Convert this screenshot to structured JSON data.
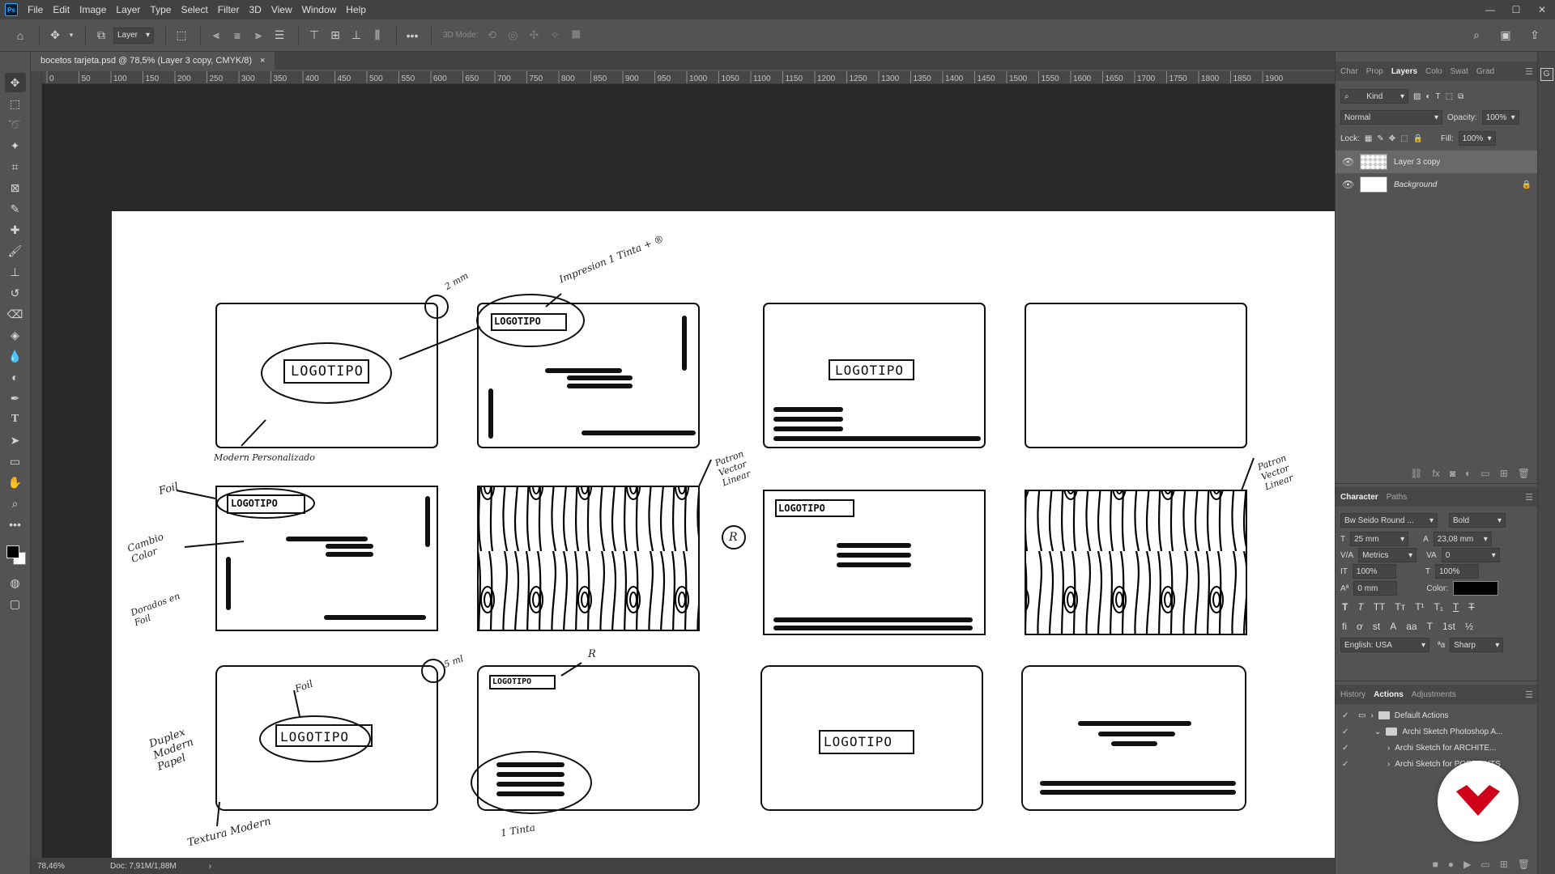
{
  "menubar": {
    "app_icon": "Ps",
    "items": [
      "File",
      "Edit",
      "Image",
      "Layer",
      "Type",
      "Select",
      "Filter",
      "3D",
      "View",
      "Window",
      "Help"
    ]
  },
  "options": {
    "auto_select_target": "Layer",
    "mode_3d_label": "3D Mode:",
    "more": "•••"
  },
  "document": {
    "tab_title": "bocetos tarjeta.psd @ 78,5% (Layer 3 copy, CMYK/8)",
    "close_glyph": "×",
    "ruler_ticks": [
      "0",
      "50",
      "100",
      "150",
      "200",
      "250",
      "300",
      "350",
      "400",
      "450",
      "500",
      "550",
      "600",
      "650",
      "700",
      "750",
      "800",
      "850",
      "900",
      "950",
      "1000",
      "1050",
      "1100",
      "1150",
      "1200",
      "1250",
      "1300",
      "1350",
      "1400",
      "1450",
      "1500",
      "1550",
      "1600",
      "1650",
      "1700",
      "1750",
      "1800",
      "1850",
      "1900"
    ]
  },
  "sketch": {
    "logo": "LOGOTIPO",
    "notes": {
      "mm2": "2 mm",
      "impresion": "Impresion 1 Tinta + ®",
      "modern": "Modern Personalizado",
      "foil": "Foil",
      "cambio_color": "Cambio Color",
      "dorados_foil": "Dorados en Foil",
      "patron1": "Patron Vector Linear",
      "patron2": "Patron Vector Linear",
      "duplex": "Duplex Modern Papel",
      "textura": "Textura Modern",
      "foil2": "Foil",
      "tinta1": "1 Tinta",
      "mm5": "5 ml",
      "reg": "R"
    }
  },
  "status": {
    "zoom": "78,46%",
    "doc": "Doc: 7,91M/1,88M"
  },
  "panels": {
    "top_tabs": [
      "Char",
      "Prop",
      "Layers",
      "Colo",
      "Swat",
      "Grad"
    ],
    "layers": {
      "kind_label": "Kind",
      "blend_mode": "Normal",
      "opacity_label": "Opacity:",
      "opacity": "100%",
      "lock_label": "Lock:",
      "fill_label": "Fill:",
      "fill": "100%",
      "items": [
        {
          "name": "Layer 3 copy",
          "selected": true
        },
        {
          "name": "Background",
          "selected": false
        }
      ]
    },
    "char_tabs": [
      "Character",
      "Paths"
    ],
    "character": {
      "font_family": "Bw Seido Round ...",
      "font_style": "Bold",
      "size": "25 mm",
      "leading": "23,08 mm",
      "kerning": "Metrics",
      "tracking": "0",
      "vscale": "100%",
      "hscale": "100%",
      "baseline": "0 mm",
      "color_label": "Color:",
      "color": "#000000",
      "language": "English: USA",
      "antialias": "Sharp"
    },
    "actions_tabs": [
      "History",
      "Actions",
      "Adjustments"
    ],
    "actions": [
      "Default Actions",
      "Archi Sketch Photoshop A...",
      "Archi Sketch for ARCHITE...",
      "Archi Sketch for PORTRAITS"
    ]
  },
  "colors": {
    "accent_red": "#d0021b"
  }
}
